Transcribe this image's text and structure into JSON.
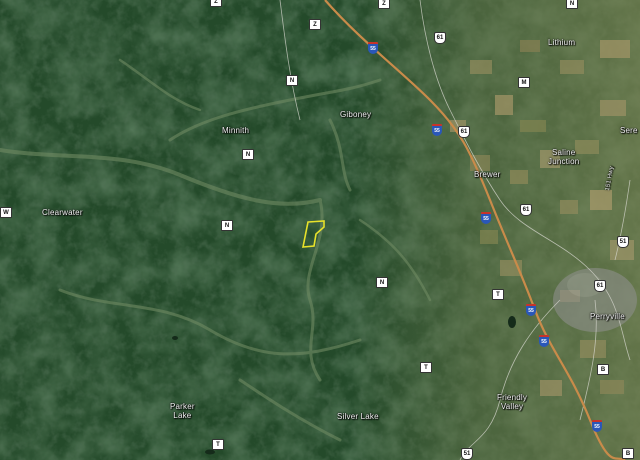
{
  "map": {
    "type": "satellite",
    "place_labels": [
      {
        "id": "lithium",
        "text": "Lithium"
      },
      {
        "id": "minnith",
        "text": "Minnith"
      },
      {
        "id": "giboney",
        "text": "Giboney"
      },
      {
        "id": "saline-junction",
        "text": "Saline\nJunction"
      },
      {
        "id": "brewer",
        "text": "Brewer"
      },
      {
        "id": "clearwater",
        "text": "Clearwater"
      },
      {
        "id": "perryville",
        "text": "Perryville"
      },
      {
        "id": "parker-lake",
        "text": "Parker\nLake"
      },
      {
        "id": "silver-lake",
        "text": "Silver Lake"
      },
      {
        "id": "friendly-valley",
        "text": "Friendly\nValley"
      },
      {
        "id": "sere",
        "text": "Sere"
      },
      {
        "id": "road-name",
        "text": "151 Hwy"
      }
    ],
    "shields": [
      {
        "id": "z-1",
        "text": "Z",
        "kind": "state"
      },
      {
        "id": "z-2",
        "text": "Z",
        "kind": "state"
      },
      {
        "id": "z-3",
        "text": "Z",
        "kind": "state"
      },
      {
        "id": "n-1",
        "text": "N",
        "kind": "state"
      },
      {
        "id": "n-2",
        "text": "N",
        "kind": "state"
      },
      {
        "id": "n-3",
        "text": "N",
        "kind": "state"
      },
      {
        "id": "n-4",
        "text": "N",
        "kind": "state"
      },
      {
        "id": "n-5",
        "text": "N",
        "kind": "state"
      },
      {
        "id": "m-1",
        "text": "M",
        "kind": "state"
      },
      {
        "id": "w-1",
        "text": "W",
        "kind": "state"
      },
      {
        "id": "t-1",
        "text": "T",
        "kind": "state"
      },
      {
        "id": "t-2",
        "text": "T",
        "kind": "state"
      },
      {
        "id": "t-3",
        "text": "T",
        "kind": "state"
      },
      {
        "id": "b-1",
        "text": "B",
        "kind": "state"
      },
      {
        "id": "b-2",
        "text": "B",
        "kind": "state"
      },
      {
        "id": "us61-1",
        "text": "61",
        "kind": "us"
      },
      {
        "id": "us61-2",
        "text": "61",
        "kind": "us"
      },
      {
        "id": "us61-3",
        "text": "61",
        "kind": "us"
      },
      {
        "id": "us61-4",
        "text": "61",
        "kind": "us"
      },
      {
        "id": "us51-1",
        "text": "51",
        "kind": "us"
      },
      {
        "id": "us51-2",
        "text": "51",
        "kind": "us"
      },
      {
        "id": "i55-1",
        "text": "55",
        "kind": "interstate"
      },
      {
        "id": "i55-2",
        "text": "55",
        "kind": "interstate"
      },
      {
        "id": "i55-3",
        "text": "55",
        "kind": "interstate"
      },
      {
        "id": "i55-4",
        "text": "55",
        "kind": "interstate"
      },
      {
        "id": "i55-5",
        "text": "55",
        "kind": "interstate"
      },
      {
        "id": "i55-6",
        "text": "55",
        "kind": "interstate"
      }
    ],
    "colors": {
      "forest": "#244a2a",
      "forest_dark": "#18331c",
      "farmland": "#8a8a5e",
      "interstate": "#c98b4a",
      "highlight_parcel": "#e8e22a"
    }
  }
}
